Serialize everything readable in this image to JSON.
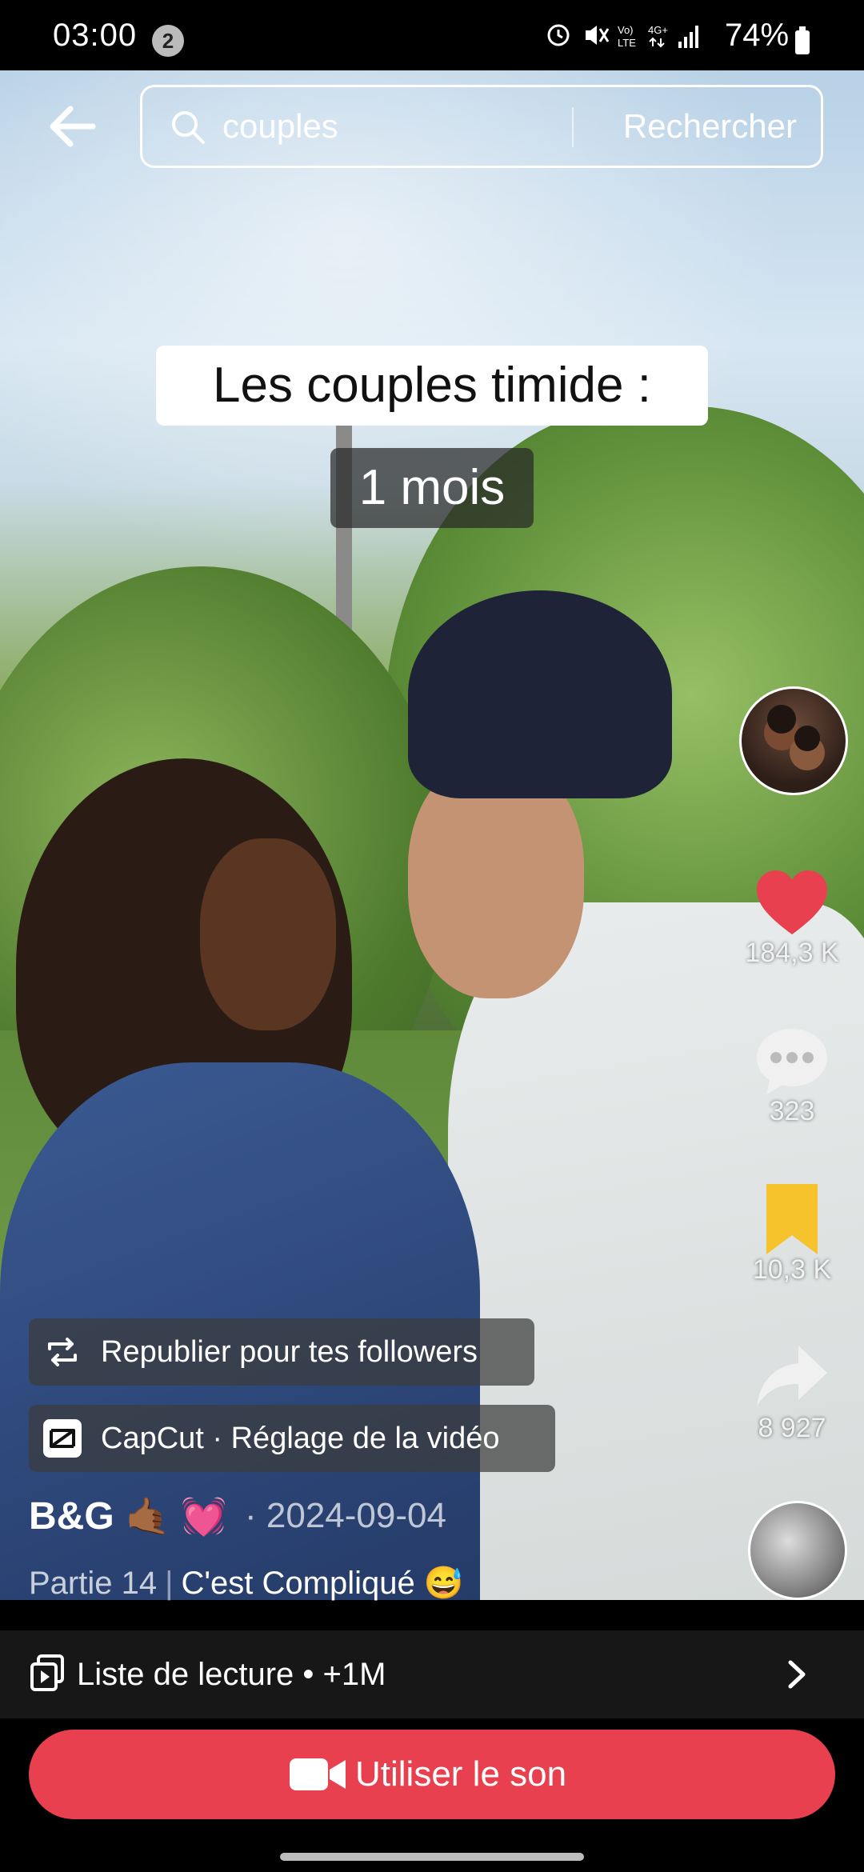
{
  "status_bar": {
    "time": "03:00",
    "notification_count": "2",
    "network_icons": "⏰ 🔇 Vo) LTE 4G+ .ıl",
    "battery": "74%"
  },
  "search": {
    "query": "couples",
    "button_label": "Rechercher"
  },
  "video_overlay": {
    "caption_line1": "Les couples timide :",
    "caption_line2": "1 mois"
  },
  "actions": {
    "likes": "184,3 K",
    "comments": "323",
    "saves": "10,3 K",
    "shares": "8 927"
  },
  "chips": {
    "repost_label": "Republier pour tes followers",
    "capcut_label": "CapCut · Réglage de la vidéo"
  },
  "post": {
    "author": "B&G",
    "author_emoji": "🤙🏾 💓",
    "date": "· 2024-09-04",
    "description_part": "Partie 14",
    "description_separator": "|",
    "description_title": "C'est Compliqué 😅"
  },
  "playlist": {
    "label": "Liste de lecture • +1M"
  },
  "cta": {
    "use_sound_label": "Utiliser le son"
  },
  "colors": {
    "accent": "#e8404f",
    "like": "#e8404f",
    "save": "#f6c32c"
  }
}
